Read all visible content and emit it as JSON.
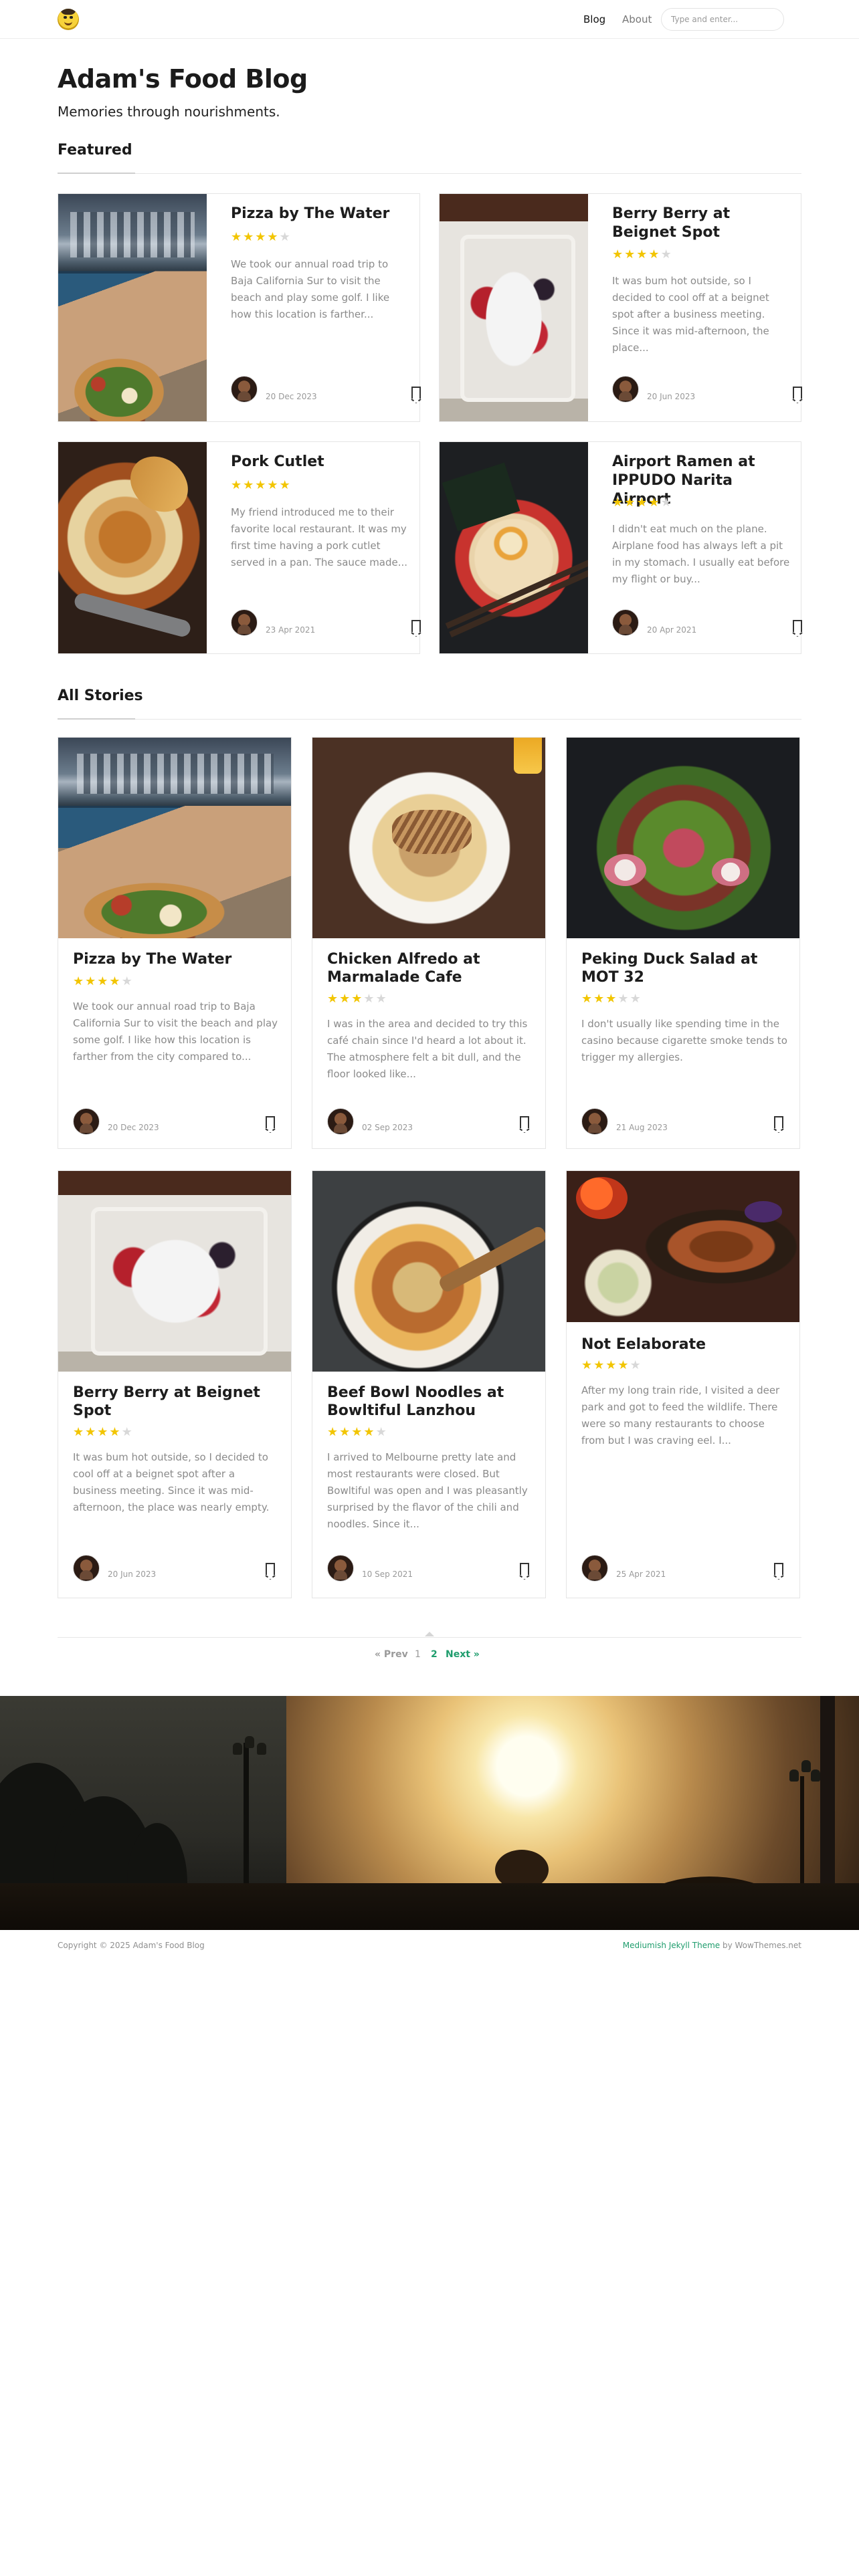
{
  "nav": {
    "links": [
      "Blog",
      "About"
    ],
    "search_placeholder": "Type and enter..."
  },
  "header": {
    "title": "Adam's Food Blog",
    "tagline": "Memories through nourishments."
  },
  "featured": {
    "heading": "Featured",
    "posts": [
      {
        "title": "Pizza by The Water",
        "rating": 4,
        "excerpt": "We took our annual road trip to Baja California Sur to visit the beach and play some golf. I like how this location is farther...",
        "date": "20 Dec 2023",
        "image": "pizza-photo"
      },
      {
        "title": "Berry Berry at Beignet Spot",
        "rating": 4,
        "excerpt": "It was bum hot outside, so I decided to cool off at a beignet spot after a business meeting. Since it was mid-afternoon, the place...",
        "date": "20 Jun 2023",
        "image": "beignet-photo"
      },
      {
        "title": "Pork Cutlet",
        "rating": 5,
        "excerpt": "My friend introduced me to their favorite local restaurant. It was my first time having a pork cutlet served in a pan. The sauce made...",
        "date": "23 Apr 2021",
        "image": "pork-cutlet-photo"
      },
      {
        "title": "Airport Ramen at IPPUDO Narita Airport",
        "rating": 4,
        "excerpt": "I didn't eat much on the plane. Airplane food has always left a pit in my stomach. I usually eat before my flight or buy...",
        "date": "20 Apr 2021",
        "image": "ramen-photo"
      }
    ]
  },
  "stories": {
    "heading": "All Stories",
    "posts": [
      {
        "title": "Pizza by The Water",
        "rating": 4,
        "excerpt": "We took our annual road trip to Baja California Sur to visit the beach and play some golf. I like how this location is farther from the city compared to...",
        "date": "20 Dec 2023",
        "image": "pizza-photo"
      },
      {
        "title": "Chicken Alfredo at Marmalade Cafe",
        "rating": 3,
        "excerpt": "I was in the area and decided to try this café chain since I'd heard a lot about it. The atmosphere felt a bit dull, and the floor looked like...",
        "date": "02 Sep 2023",
        "image": "alfredo-photo"
      },
      {
        "title": "Peking Duck Salad at MOT 32",
        "rating": 3,
        "excerpt": "I don't usually like spending time in the casino because cigarette smoke tends to trigger my allergies.",
        "date": "21 Aug 2023",
        "image": "duck-salad-photo"
      },
      {
        "title": "Berry Berry at Beignet Spot",
        "rating": 4,
        "excerpt": "It was bum hot outside, so I decided to cool off at a beignet spot after a business meeting. Since it was mid-afternoon, the place was nearly empty.",
        "date": "20 Jun 2023",
        "image": "beignet-photo"
      },
      {
        "title": "Beef Bowl Noodles at Bowltiful Lanzhou",
        "rating": 4,
        "excerpt": "I arrived to Melbourne pretty late and most restaurants were closed. But Bowltiful was open and I was pleasantly surprised by the flavor of the chili and noodles. Since it...",
        "date": "10 Sep 2021",
        "image": "beef-noodles-photo"
      },
      {
        "title": "Not Eelaborate",
        "rating": 4,
        "excerpt": "After my long train ride, I visited a deer park and got to feed the wildlife. There were so many restaurants to choose from but I was craving eel. I...",
        "date": "25 Apr 2021",
        "image": "eel-photo"
      }
    ]
  },
  "pagination": {
    "prev": "« Prev",
    "pages": [
      "1",
      "2"
    ],
    "current": "2",
    "next": "Next »"
  },
  "footer": {
    "copyright": "Copyright © 2025 Adam's Food Blog",
    "theme_link": "Mediumish Jekyll Theme",
    "theme_by": " by WowThemes.net"
  },
  "colors": {
    "accent": "#1f9d6d",
    "star": "#f2c500",
    "star_off": "#d8d8d8",
    "excerpt": "#8a8a8a"
  }
}
